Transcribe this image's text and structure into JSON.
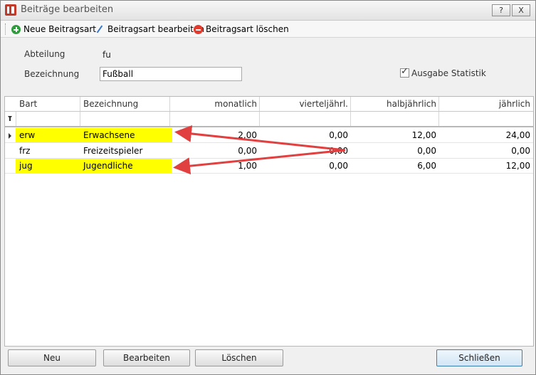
{
  "window": {
    "title": "Beiträge bearbeiten",
    "help_label": "?",
    "close_label": "X"
  },
  "toolbar": {
    "new_label": "Neue Beitragsart",
    "edit_label": "Beitragsart bearbeiten",
    "delete_label": "Beitragsart löschen"
  },
  "form": {
    "abteilung_label": "Abteilung",
    "abteilung_value": "fu",
    "bezeichnung_label": "Bezeichnung",
    "bezeichnung_value": "Fußball",
    "statistik_label": "Ausgabe Statistik",
    "statistik_checked": true
  },
  "grid": {
    "columns": [
      "Bart",
      "Bezeichnung",
      "monatlich",
      "vierteljährl.",
      "halbjährlich",
      "jährlich"
    ],
    "rows": [
      {
        "bart": "erw",
        "bezeichnung": "Erwachsene",
        "monatlich": "2,00",
        "vierteljaehrl": "0,00",
        "halbjaehrlich": "12,00",
        "jaehrlich": "24,00"
      },
      {
        "bart": "frz",
        "bezeichnung": "Freizeitspieler",
        "monatlich": "0,00",
        "vierteljaehrl": "0,00",
        "halbjaehrlich": "0,00",
        "jaehrlich": "0,00"
      },
      {
        "bart": "jug",
        "bezeichnung": "Jugendliche",
        "monatlich": "1,00",
        "vierteljaehrl": "0,00",
        "halbjaehrlich": "6,00",
        "jaehrlich": "12,00"
      }
    ]
  },
  "buttons": {
    "neu": "Neu",
    "bearbeiten": "Bearbeiten",
    "loeschen": "Löschen",
    "schliessen": "Schließen"
  },
  "colors": {
    "highlight": "#ffff00",
    "arrow": "#e04040"
  }
}
